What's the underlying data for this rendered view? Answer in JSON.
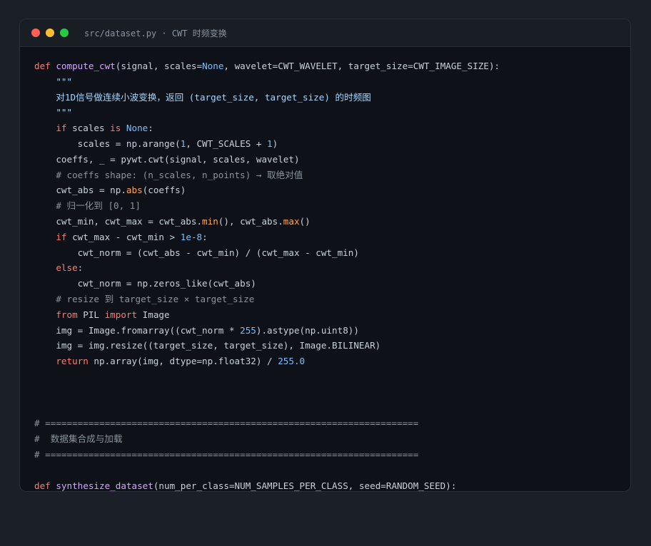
{
  "window": {
    "title": "src/dataset.py · CWT 时频变换",
    "dots": [
      "#ff5f57",
      "#febc2e",
      "#28c840"
    ]
  },
  "code_lines": [
    [
      [
        "kw",
        "def "
      ],
      [
        "fn",
        "compute_cwt"
      ],
      [
        "plain",
        "(signal, scales="
      ],
      [
        "const",
        "None"
      ],
      [
        "plain",
        ", wavelet=CWT_WAVELET, target_size=CWT_IMAGE_SIZE):"
      ]
    ],
    [
      [
        "str",
        "    \"\"\""
      ]
    ],
    [
      [
        "str",
        "    对1D信号做连续小波变换，返回 (target_size, target_size) 的时频图"
      ]
    ],
    [
      [
        "str",
        "    \"\"\""
      ]
    ],
    [
      [
        "kw",
        "    if "
      ],
      [
        "plain",
        "scales "
      ],
      [
        "kw",
        "is "
      ],
      [
        "const",
        "None"
      ],
      [
        "plain",
        ":"
      ]
    ],
    [
      [
        "plain",
        "        scales = np.arange("
      ],
      [
        "num",
        "1"
      ],
      [
        "plain",
        ", CWT_SCALES + "
      ],
      [
        "num",
        "1"
      ],
      [
        "plain",
        ")"
      ]
    ],
    [
      [
        "plain",
        "    coeffs, _ = pywt.cwt(signal, scales, wavelet)"
      ]
    ],
    [
      [
        "cm",
        "    # coeffs shape: (n_scales, n_points) → 取绝对值"
      ]
    ],
    [
      [
        "plain",
        "    cwt_abs = np."
      ],
      [
        "bi",
        "abs"
      ],
      [
        "plain",
        "(coeffs)"
      ]
    ],
    [
      [
        "cm",
        "    # 归一化到 [0, 1]"
      ]
    ],
    [
      [
        "plain",
        "    cwt_min, cwt_max = cwt_abs."
      ],
      [
        "bi",
        "min"
      ],
      [
        "plain",
        "(), cwt_abs."
      ],
      [
        "bi",
        "max"
      ],
      [
        "plain",
        "()"
      ]
    ],
    [
      [
        "kw",
        "    if "
      ],
      [
        "plain",
        "cwt_max - cwt_min > "
      ],
      [
        "num",
        "1e-8"
      ],
      [
        "plain",
        ":"
      ]
    ],
    [
      [
        "plain",
        "        cwt_norm = (cwt_abs - cwt_min) / (cwt_max - cwt_min)"
      ]
    ],
    [
      [
        "kw",
        "    else"
      ],
      [
        "plain",
        ":"
      ]
    ],
    [
      [
        "plain",
        "        cwt_norm = np.zeros_like(cwt_abs)"
      ]
    ],
    [
      [
        "cm",
        "    # resize 到 target_size × target_size"
      ]
    ],
    [
      [
        "kw",
        "    from "
      ],
      [
        "plain",
        "PIL "
      ],
      [
        "kw",
        "import "
      ],
      [
        "plain",
        "Image"
      ]
    ],
    [
      [
        "plain",
        "    img = Image.fromarray((cwt_norm * "
      ],
      [
        "num",
        "255"
      ],
      [
        "plain",
        ").astype(np.uint8))"
      ]
    ],
    [
      [
        "plain",
        "    img = img.resize((target_size, target_size), Image.BILINEAR)"
      ]
    ],
    [
      [
        "kw",
        "    return "
      ],
      [
        "plain",
        "np.array(img, dtype=np.float32) / "
      ],
      [
        "num",
        "255.0"
      ]
    ],
    [],
    [],
    [],
    [
      [
        "cm",
        "# ====================================================================="
      ]
    ],
    [
      [
        "cm",
        "#  数据集合成与加载"
      ]
    ],
    [
      [
        "cm",
        "# ====================================================================="
      ]
    ],
    [],
    [
      [
        "kw",
        "def "
      ],
      [
        "fn",
        "synthesize_dataset"
      ],
      [
        "plain",
        "(num_per_class=NUM_SAMPLES_PER_CLASS, seed=RANDOM_SEED):"
      ]
    ]
  ]
}
